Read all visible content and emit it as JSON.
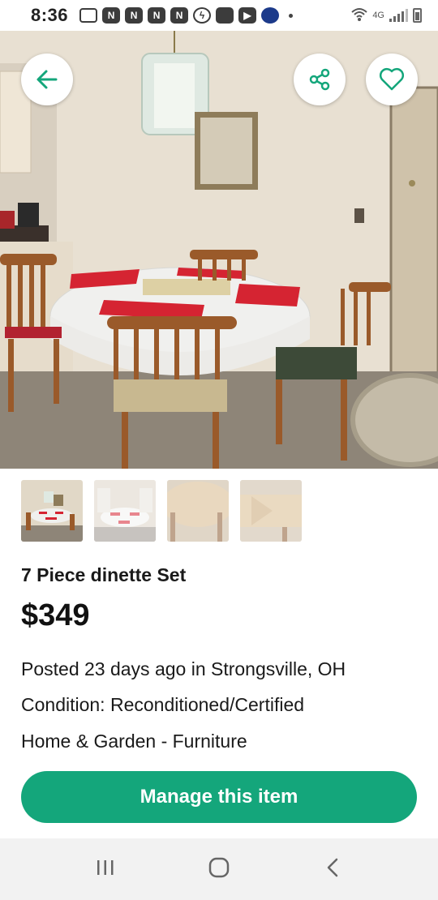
{
  "status_bar": {
    "time": "8:36",
    "network": "4G",
    "icons": [
      "message-icon",
      "n-icon",
      "n-icon",
      "n-icon",
      "n-icon",
      "lightning-icon",
      "call-filter-icon",
      "youtube-icon",
      "moon-icon"
    ]
  },
  "top_actions": {
    "back_icon": "arrow-left-icon",
    "share_icon": "share-icon",
    "favorite_icon": "heart-icon",
    "accent": "#14a67b"
  },
  "thumbnails": {
    "count": 4,
    "selected": 1
  },
  "listing": {
    "title": "7 Piece dinette Set",
    "price": "$349",
    "posted": "Posted 23 days ago in Strongsville, OH",
    "condition": "Condition: Reconditioned/Certified",
    "category": "Home & Garden - Furniture"
  },
  "actions": {
    "manage_label": "Manage this item",
    "button_color": "#14a67b"
  },
  "nav": {
    "icons": [
      "recent-apps-icon",
      "home-icon",
      "back-icon"
    ]
  }
}
